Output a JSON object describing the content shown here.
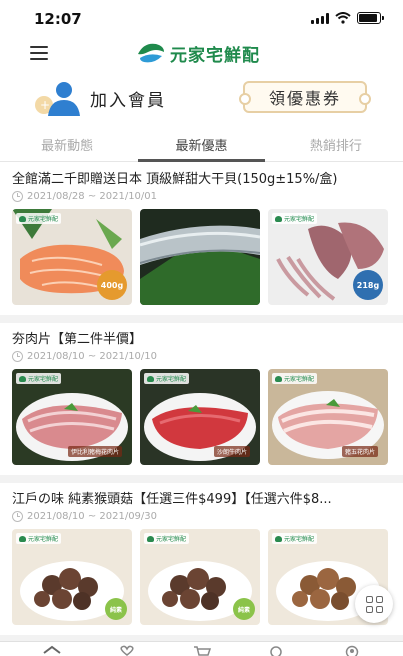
{
  "status": {
    "time": "12:07",
    "battery_level": 0.9
  },
  "header": {
    "logo_text": "元家宅鮮配",
    "menu_icon": "hamburger-icon"
  },
  "member": {
    "join_label": "加入會員",
    "coupon_label": "領優惠券"
  },
  "tabs": [
    {
      "label": "最新動態",
      "active": false
    },
    {
      "label": "最新優惠",
      "active": true
    },
    {
      "label": "熱銷排行",
      "active": false
    }
  ],
  "promotions": [
    {
      "title": "全館滿二千即贈送日本 頂級鮮甜大干貝(150g±15%/盒)",
      "date": "2021/08/28 ~ 2021/10/01",
      "thumbs": [
        {
          "logo": "元家宅鮮配",
          "badge": "400g",
          "kind": "salmon"
        },
        {
          "logo": "",
          "badge": "",
          "kind": "fish"
        },
        {
          "logo": "元家宅鮮配",
          "badge": "218g",
          "kind": "squid"
        }
      ]
    },
    {
      "title": "夯肉片【第二件半價】",
      "date": "2021/08/10 ~ 2021/10/10",
      "thumbs": [
        {
          "logo": "元家宅鮮配",
          "caption": "伊比利豬梅花肉片",
          "kind": "pork"
        },
        {
          "logo": "元家宅鮮配",
          "caption": "沙朗牛肉片",
          "kind": "beef"
        },
        {
          "logo": "元家宅鮮配",
          "caption": "豬五花肉片",
          "kind": "bacon"
        }
      ]
    },
    {
      "title": "江戶の味 純素猴頭菇【任選三件$499】【任選六件$8...",
      "date": "2021/08/10 ~ 2021/09/30",
      "thumbs": [
        {
          "logo": "元家宅鮮配",
          "badge": "純素",
          "kind": "mushroom"
        },
        {
          "logo": "元家宅鮮配",
          "badge": "純素",
          "kind": "mushroom"
        },
        {
          "logo": "元家宅鮮配",
          "badge": "純素",
          "kind": "mushroom2"
        }
      ]
    }
  ],
  "floating_button": {
    "icon": "grid-icon"
  },
  "bottom_nav": [
    {
      "icon": "home-icon"
    },
    {
      "icon": "heart-icon"
    },
    {
      "icon": "cart-icon"
    },
    {
      "icon": "search-icon"
    },
    {
      "icon": "user-icon"
    }
  ],
  "colors": {
    "brand_green": "#1f8a4c",
    "coupon_border": "#e7cfa4",
    "badge_orange": "#e59a2e"
  }
}
